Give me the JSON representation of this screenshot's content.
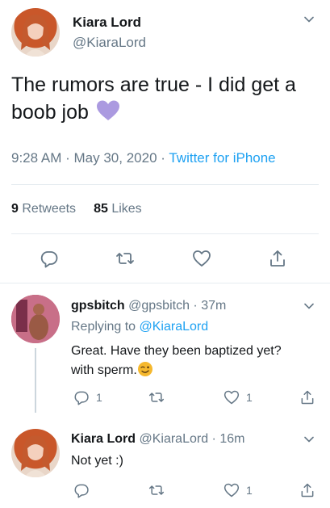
{
  "main_tweet": {
    "author_name": "Kiara Lord",
    "author_handle": "@KiaraLord",
    "text": "The rumors are true - I did get a boob job",
    "emoji": "purple-heart",
    "time": "9:28 AM",
    "dot1": "·",
    "date": "May 30, 2020",
    "dot2": "·",
    "source": "Twitter for iPhone",
    "retweets_count": "9",
    "retweets_label": "Retweets",
    "likes_count": "85",
    "likes_label": "Likes"
  },
  "replies": [
    {
      "author_name": "gpsbitch",
      "author_handle": "@gpsbitch",
      "dot": "·",
      "time_ago": "37m",
      "replying_label": "Replying to",
      "replying_to": "@KiaraLord",
      "text_line1": "Great.  Have they been baptized yet?",
      "text_line2": "with sperm.",
      "emoji": "winking-face",
      "reply_count": "1",
      "like_count": "1"
    },
    {
      "author_name": "Kiara Lord",
      "author_handle": "@KiaraLord",
      "dot": "·",
      "time_ago": "16m",
      "text_line1": "Not yet :)",
      "like_count": "1"
    }
  ],
  "colors": {
    "accent": "#1da1f2",
    "muted": "#657786",
    "heart_purple": "#ab9ae0",
    "divider": "#e6ecf0"
  }
}
